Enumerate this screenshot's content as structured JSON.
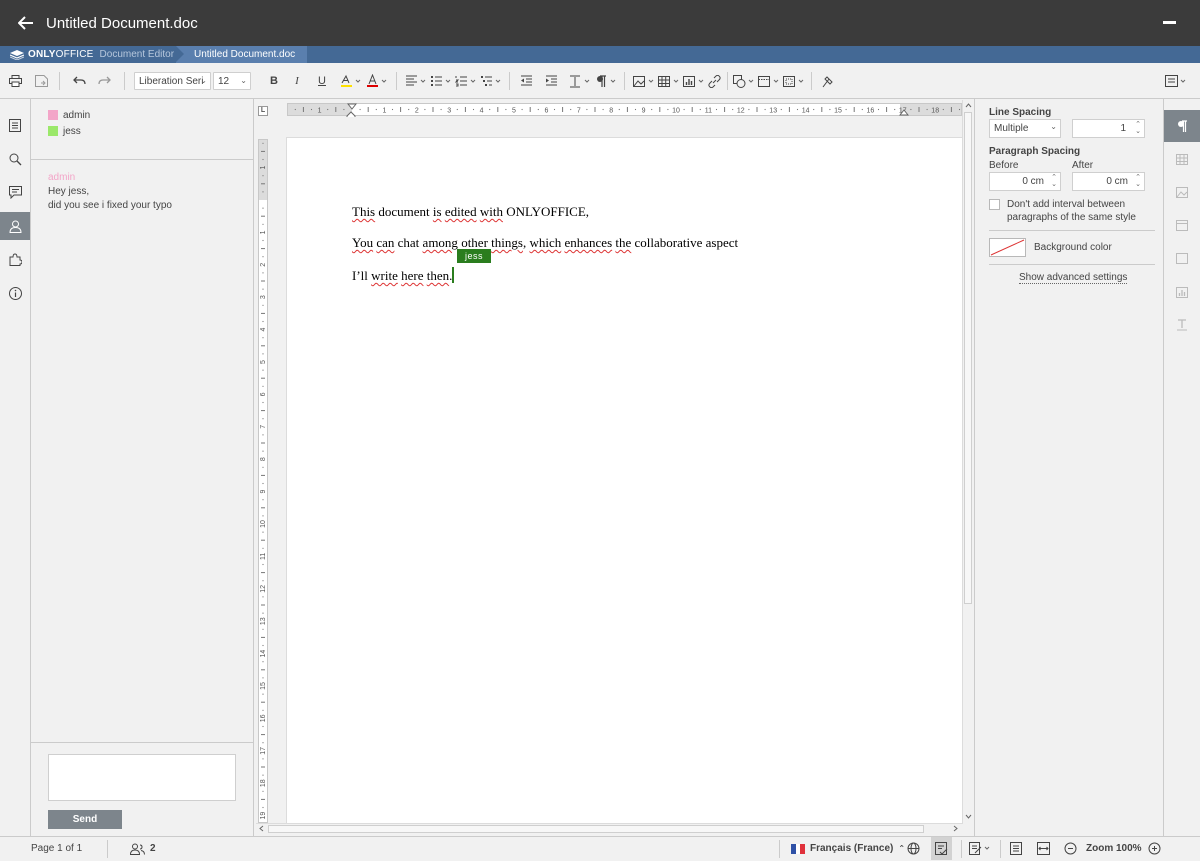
{
  "window": {
    "title": "Untitled Document.doc"
  },
  "brand": {
    "logo_bold": "ONLY",
    "logo_rest": "OFFICE",
    "product": "Document Editor",
    "doc_tab": "Untitled Document.doc"
  },
  "toolbar": {
    "font_name": "Liberation Seri",
    "font_size": "12",
    "icons": [
      "print-icon",
      "save-icon",
      "undo-icon",
      "redo-icon",
      "bold-icon",
      "italic-icon",
      "underline-icon",
      "highlight-icon",
      "font-color-icon",
      "align-left-icon",
      "bullets-icon",
      "numbering-icon",
      "multilevel-icon",
      "decrease-indent-icon",
      "increase-indent-icon",
      "line-spacing-icon",
      "nonprinting-icon",
      "image-icon",
      "table-icon",
      "chart-icon",
      "link-icon",
      "shape-icon",
      "header-footer-icon",
      "page-margins-icon",
      "copy-style-icon",
      "view-settings-icon"
    ],
    "bold_label": "B",
    "italic_label": "I",
    "underline_label": "U",
    "font_color_label": "A"
  },
  "chat": {
    "users": [
      {
        "name": "admin",
        "color": "#f3a5c8"
      },
      {
        "name": "jess",
        "color": "#9be86a"
      }
    ],
    "messages": [
      {
        "author": "admin",
        "text": "Hey jess,\ndid you see i fixed your typo"
      }
    ],
    "send_label": "Send",
    "input_value": ""
  },
  "document": {
    "paragraphs": [
      {
        "segments": [
          {
            "text": "This",
            "spell": true
          },
          {
            "text": " document ",
            "spell": false
          },
          {
            "text": "is",
            "spell": true
          },
          {
            "text": " ",
            "spell": false
          },
          {
            "text": "edited",
            "spell": true
          },
          {
            "text": " ",
            "spell": false
          },
          {
            "text": "with",
            "spell": true
          },
          {
            "text": " ONLYOFFICE,",
            "spell": false
          }
        ]
      },
      {
        "segments": [
          {
            "text": "You",
            "spell": true
          },
          {
            "text": " ",
            "spell": false
          },
          {
            "text": "can",
            "spell": true
          },
          {
            "text": " chat ",
            "spell": false
          },
          {
            "text": "among",
            "spell": true
          },
          {
            "text": " ",
            "spell": false
          },
          {
            "text": "other",
            "spell": true
          },
          {
            "text": " ",
            "spell": false
          },
          {
            "text": "things",
            "spell": true
          },
          {
            "text": ", ",
            "spell": false
          },
          {
            "text": "which",
            "spell": true
          },
          {
            "text": " ",
            "spell": false
          },
          {
            "text": "enhances",
            "spell": true
          },
          {
            "text": " ",
            "spell": false
          },
          {
            "text": "the",
            "spell": true
          },
          {
            "text": " collaborative aspect",
            "spell": false
          }
        ]
      },
      {
        "segments": [
          {
            "text": "I’ll",
            "spell": false
          },
          {
            "text": " ",
            "spell": false
          },
          {
            "text": "write",
            "spell": true
          },
          {
            "text": " ",
            "spell": false
          },
          {
            "text": "here",
            "spell": true
          },
          {
            "text": " ",
            "spell": false
          },
          {
            "text": "then",
            "spell": true
          },
          {
            "text": ".",
            "spell": false
          }
        ]
      }
    ],
    "cursor_user": "jess",
    "cursor_color": "#2a7d1e",
    "h_ruler_labels": [
      "1",
      "1",
      "2",
      "3",
      "4",
      "5",
      "6",
      "7",
      "8",
      "9",
      "10",
      "11",
      "12",
      "13",
      "14",
      "15",
      "16",
      "17",
      "18"
    ],
    "v_ruler_labels": [
      "1",
      "1",
      "2",
      "3",
      "4",
      "5",
      "6",
      "7",
      "8",
      "9",
      "10",
      "11",
      "12",
      "13",
      "14",
      "15",
      "16",
      "17",
      "18",
      "19"
    ]
  },
  "right_panel": {
    "line_spacing_label": "Line Spacing",
    "line_spacing_type": "Multiple",
    "line_spacing_value": "1",
    "paragraph_spacing_label": "Paragraph Spacing",
    "before_label": "Before",
    "after_label": "After",
    "before_value": "0 cm",
    "after_value": "0 cm",
    "no_interval_label_1": "Don't add interval between",
    "no_interval_label_2": "paragraphs of the same style",
    "background_color_label": "Background color",
    "advanced_link": "Show advanced settings"
  },
  "statusbar": {
    "page_info": "Page 1 of 1",
    "users_count": "2",
    "language": "Français (France)",
    "zoom": "Zoom 100%"
  }
}
